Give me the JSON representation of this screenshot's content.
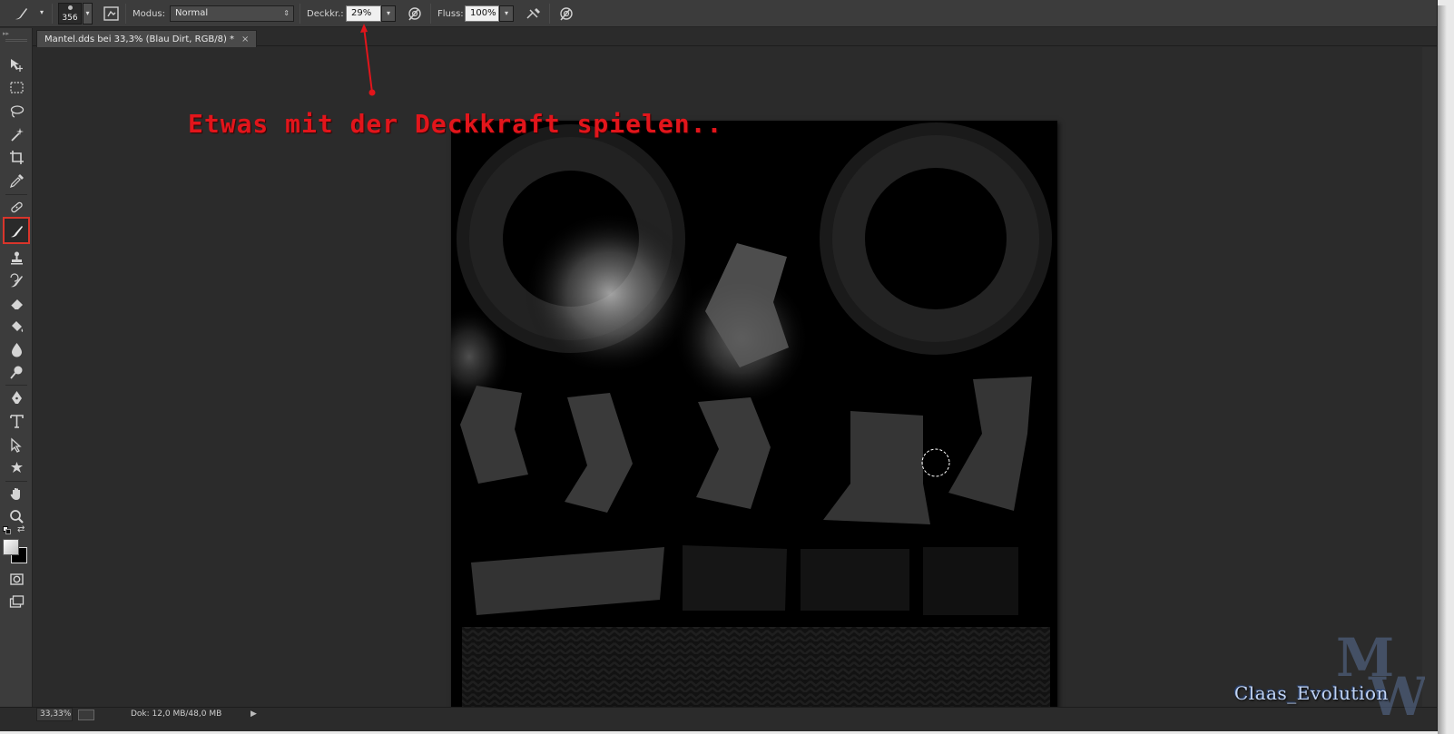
{
  "options_bar": {
    "brush_size": "356",
    "mode_label": "Modus:",
    "mode_value": "Normal",
    "opacity_label": "Deckkr.:",
    "opacity_value": "29%",
    "flow_label": "Fluss:",
    "flow_value": "100%"
  },
  "document": {
    "tab_title": "Mantel.dds bei 33,3% (Blau Dirt, RGB/8) *",
    "tab_close": "×"
  },
  "annotation": {
    "text": "Etwas mit der Deckkraft spielen..",
    "color": "#e2151b"
  },
  "status_bar": {
    "zoom": "33,33%",
    "doc_size": "Dok: 12,0 MB/48,0 MB"
  },
  "watermark": {
    "logo": "MW",
    "text": "Claas_Evolution"
  },
  "tools": [
    "move-tool-icon",
    "rectangular-marquee-icon",
    "lasso-icon",
    "magic-wand-icon",
    "crop-icon",
    "eyedropper-icon",
    "healing-brush-icon",
    "brush-icon",
    "clone-stamp-icon",
    "history-brush-icon",
    "eraser-icon",
    "paint-bucket-icon",
    "blur-icon",
    "dodge-icon",
    "pen-icon",
    "type-icon",
    "path-selection-icon",
    "custom-shape-icon",
    "hand-icon",
    "zoom-icon",
    "quick-mask-icon",
    "screen-mode-icon"
  ],
  "colors": {
    "foreground": "#e0e0e0",
    "background": "#000000",
    "highlight": "#d9352b"
  }
}
